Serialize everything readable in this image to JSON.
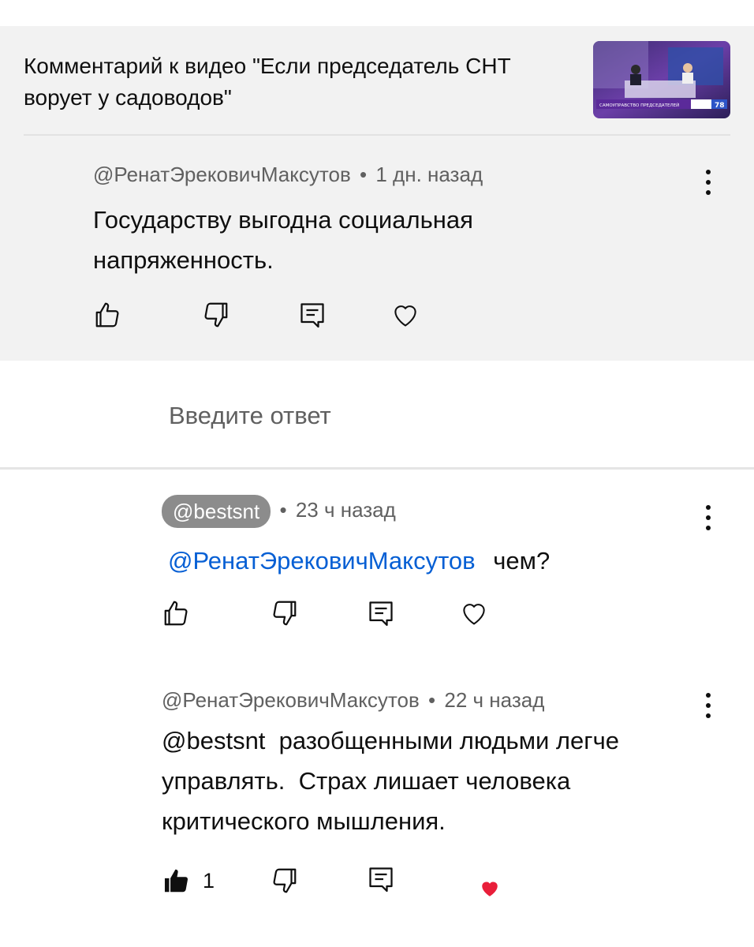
{
  "video": {
    "title": "Комментарий к видео \"Если председатель СНТ ворует у садоводов\"",
    "thumbnail_icon": "tv-news-studio-thumbnail",
    "thumbnail_caption": "САМОУПРАВСТВО ПРЕДСЕДАТЕЛЕЙ",
    "thumbnail_channel": "78"
  },
  "comments": [
    {
      "author": "@РенатЭрековичМаксутов",
      "separator": "•",
      "time": "1 дн. назад",
      "text": "Государству выгодна социальная напряженность.",
      "likes": "",
      "liked": false,
      "hearted": false
    },
    {
      "author": "@bestsnt",
      "separator": "•",
      "time": "23 ч назад",
      "mention": "@РенатЭрековичМаксутов",
      "text": "чем?",
      "likes": "",
      "liked": false,
      "hearted": false
    },
    {
      "author": "@РенатЭрековичМаксутов",
      "separator": "•",
      "time": "22 ч назад",
      "text": "@bestsnt  разобщенными людьми легче управлять.  Страх лишает человека критического мышления.",
      "likes": "1",
      "liked": true,
      "hearted": true
    }
  ],
  "reply_input": {
    "placeholder": "Введите ответ"
  },
  "icons": {
    "like": "thumbs-up-icon",
    "dislike": "thumbs-down-icon",
    "reply": "reply-icon",
    "heart": "heart-icon",
    "menu": "more-vert-icon"
  },
  "colors": {
    "header_bg": "#f2f2f2",
    "mention": "#065fd4",
    "heart_red": "#e91e3a",
    "chip_bg": "#8c8c8c"
  }
}
